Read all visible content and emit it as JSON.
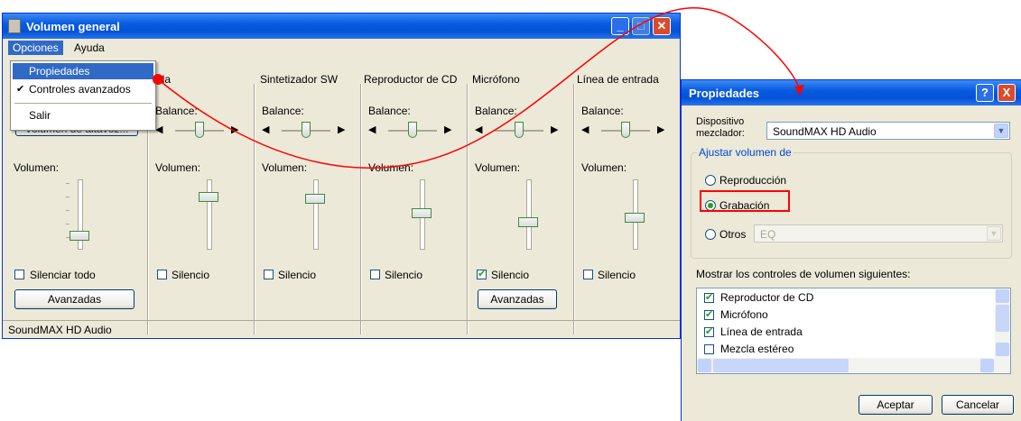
{
  "colors": {
    "accent": "#0a5be0",
    "annotation": "#ff0000",
    "check": "#21a121",
    "close": "#d94b2b"
  },
  "main": {
    "title": "Volumen general",
    "menu": {
      "opciones": "Opciones",
      "ayuda": "Ayuda"
    },
    "dropdown": {
      "propiedades": "Propiedades",
      "controles": "Controles avanzados",
      "salir": "Salir",
      "check": "✔"
    },
    "columns": [
      {
        "header": "",
        "balance_partial": "Volumen de altavoz...",
        "volume": "Volumen:",
        "mute": "Silenciar todo",
        "muted": false,
        "adv": "Avanzadas"
      },
      {
        "header": "ida",
        "balance": "Balance:",
        "volume": "Volumen:",
        "mute": "Silencio",
        "muted": false
      },
      {
        "header": "Sintetizador SW",
        "balance": "Balance:",
        "volume": "Volumen:",
        "mute": "Silencio",
        "muted": false
      },
      {
        "header": "Reproductor de CD",
        "balance": "Balance:",
        "volume": "Volumen:",
        "mute": "Silencio",
        "muted": false
      },
      {
        "header": "Micrófono",
        "balance": "Balance:",
        "volume": "Volumen:",
        "mute": "Silencio",
        "muted": true,
        "adv": "Avanzadas"
      },
      {
        "header": "Línea de entrada",
        "balance": "Balance:",
        "volume": "Volumen:",
        "mute": "Silencio",
        "muted": false
      }
    ],
    "status": "SoundMAX HD Audio"
  },
  "props": {
    "title": "Propiedades",
    "help_btn": "?",
    "close_btn": "X",
    "mixer_label_1": "Dispositivo",
    "mixer_label_2": "mezclador:",
    "mixer_value": "SoundMAX HD Audio",
    "group_label": "Ajustar volumen de",
    "opt_repro": "Reproducción",
    "opt_grab": "Grabación",
    "opt_otros": "Otros",
    "otros_value": "EQ",
    "show_label": "Mostrar los controles de volumen siguientes:",
    "items": [
      {
        "label": "Reproductor de CD",
        "checked": true
      },
      {
        "label": "Micrófono",
        "checked": true
      },
      {
        "label": "Línea de entrada",
        "checked": true
      },
      {
        "label": "Mezcla estéreo",
        "checked": false
      }
    ],
    "ok": "Aceptar",
    "cancel": "Cancelar"
  }
}
